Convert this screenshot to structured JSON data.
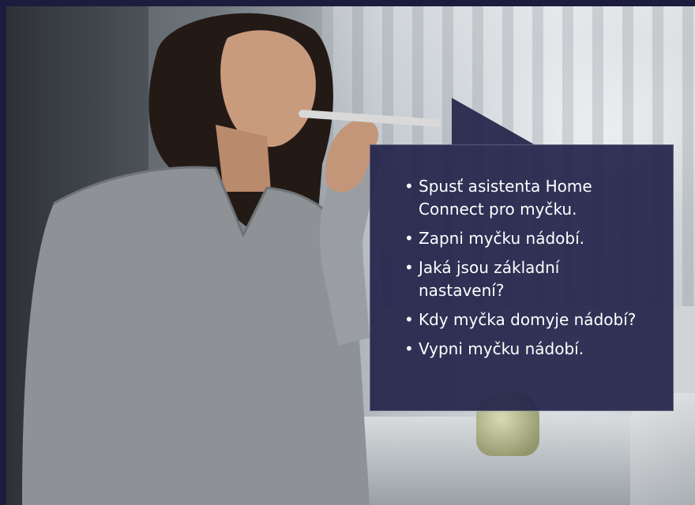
{
  "colors": {
    "page_background": "#1c1c3e",
    "bubble_background": "#22244a",
    "bubble_text": "#ffffff"
  },
  "photo": {
    "subject": "woman-speaking-into-phone-icon"
  },
  "speech_bubble": {
    "commands": [
      "Spusť asistenta Home Connect pro myčku.",
      "Zapni myčku nádobí.",
      "Jaká jsou základní nastavení?",
      "Kdy myčka domyje nádobí?",
      "Vypni myčku nádobí."
    ]
  }
}
